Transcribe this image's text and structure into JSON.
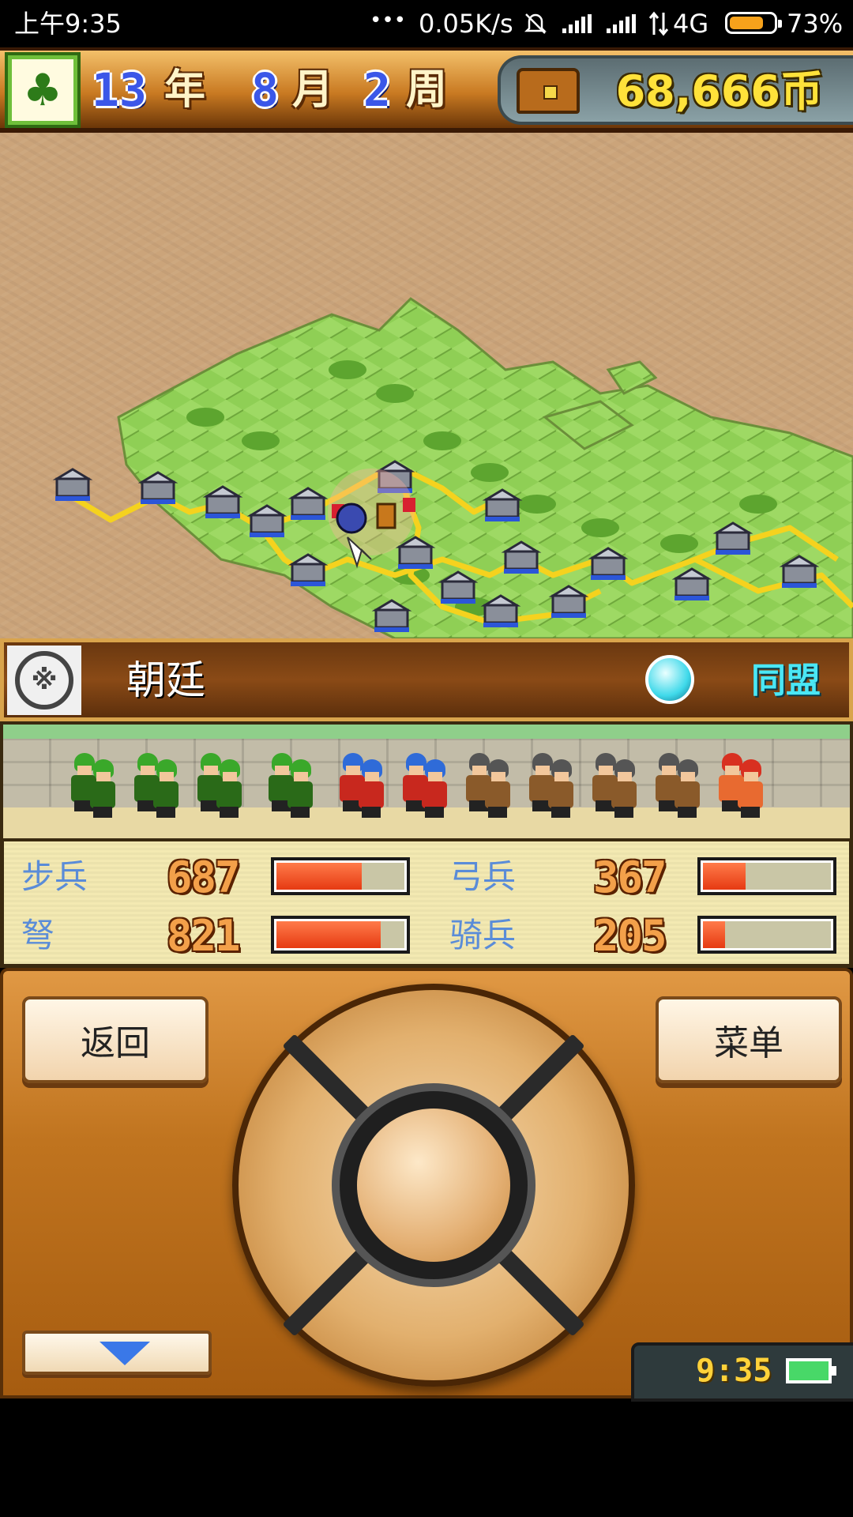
{
  "status_bar": {
    "time": "上午9:35",
    "dots": "•••",
    "speed": "0.05K/s",
    "network": "4G",
    "battery": "73%",
    "icons": [
      "alarm-off-icon",
      "signal-icon",
      "signal-icon",
      "data-arrows-icon",
      "battery-icon"
    ]
  },
  "header": {
    "year": "13",
    "year_label": "年",
    "month": "8",
    "month_label": "月",
    "week": "2",
    "week_label": "周",
    "coins": "68,666币",
    "icons": [
      "pine-tree-icon",
      "treasure-chest-icon"
    ]
  },
  "faction": {
    "emblem": "※",
    "name": "朝廷",
    "status": "同盟",
    "colors": {
      "status": "#4ae7f5",
      "orb": "#3fd9ea"
    }
  },
  "stats": [
    {
      "label": "步兵",
      "value": "687",
      "fill": 0.68
    },
    {
      "label": "弓兵",
      "value": "367",
      "fill": 0.36
    },
    {
      "label": "弩",
      "value": "821",
      "fill": 0.82
    },
    {
      "label": "骑兵",
      "value": "205",
      "fill": 0.2
    }
  ],
  "controls": {
    "back_label": "返回",
    "menu_label": "菜单",
    "clock": "9:35"
  }
}
